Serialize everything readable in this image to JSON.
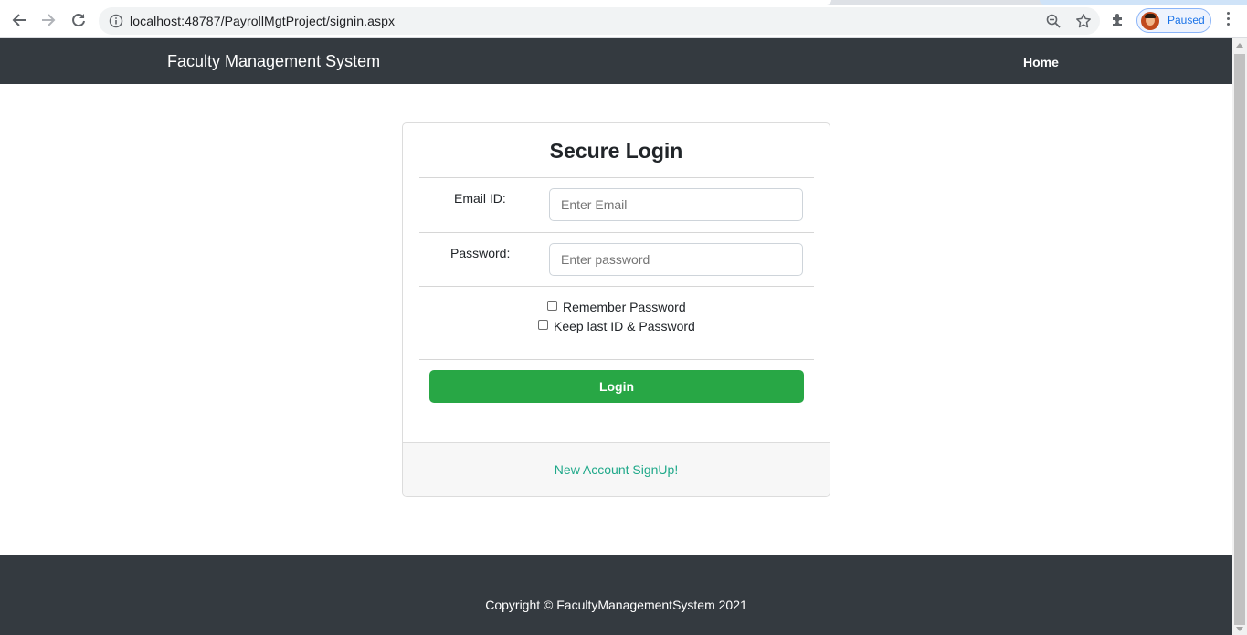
{
  "browser": {
    "url": "localhost:48787/PayrollMgtProject/signin.aspx",
    "profile_status": "Paused",
    "icons": [
      "back-icon",
      "forward-icon",
      "reload-icon",
      "info-icon",
      "zoom-icon",
      "star-icon",
      "extensions-icon",
      "menu-icon"
    ]
  },
  "navbar": {
    "brand": "Faculty Management System",
    "home": "Home"
  },
  "login": {
    "title": "Secure Login",
    "email_label": "Email ID:",
    "email_placeholder": "Enter Email",
    "email_value": "",
    "password_label": "Password:",
    "password_placeholder": "Enter password",
    "password_value": "",
    "remember_label": "Remember Password",
    "remember_checked": false,
    "keep_label": "Keep last ID & Password",
    "keep_checked": false,
    "login_button": "Login",
    "signup_link": "New Account SignUp!"
  },
  "footer": {
    "copyright": "Copyright © FacultyManagementSystem 2021"
  },
  "colors": {
    "navbar_bg": "#343a40",
    "login_button": "#28a745",
    "signup_link": "#20a98a"
  }
}
